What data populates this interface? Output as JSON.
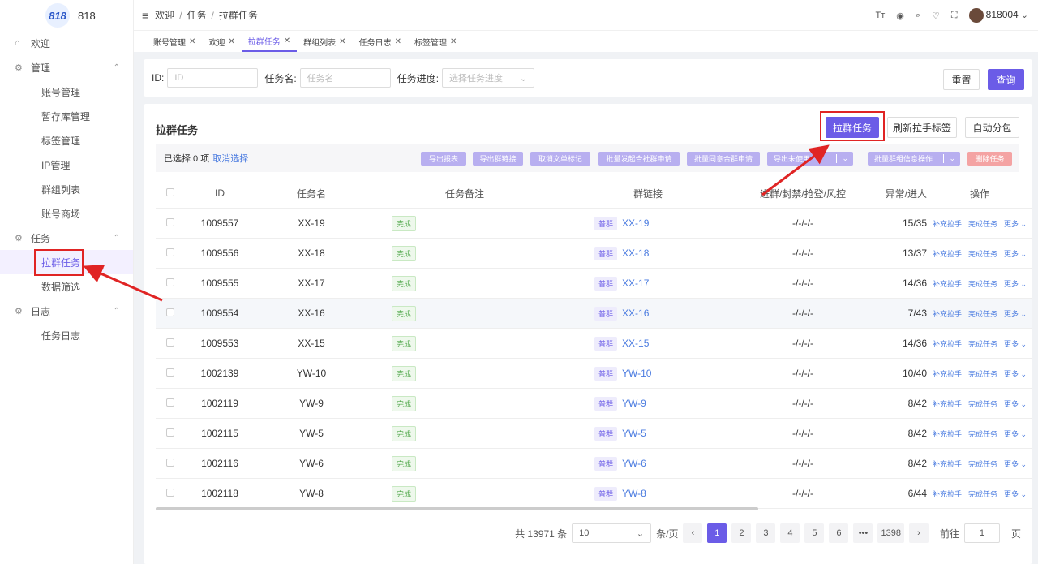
{
  "app": {
    "logo_mark": "818",
    "logo_text": "818"
  },
  "sidebar": {
    "items": [
      {
        "label": "欢迎",
        "icon": "home-icon"
      },
      {
        "label": "管理",
        "icon": "settings-icon"
      },
      {
        "label": "账号管理"
      },
      {
        "label": "暂存库管理"
      },
      {
        "label": "标签管理"
      },
      {
        "label": "IP管理"
      },
      {
        "label": "群组列表"
      },
      {
        "label": "账号商场"
      },
      {
        "label": "任务",
        "icon": "settings-icon"
      },
      {
        "label": "拉群任务"
      },
      {
        "label": "数据筛选"
      },
      {
        "label": "日志",
        "icon": "settings-icon"
      },
      {
        "label": "任务日志"
      }
    ]
  },
  "header": {
    "breadcrumb": [
      "欢迎",
      "任务",
      "拉群任务"
    ],
    "user": "818004"
  },
  "tabs": [
    "账号管理",
    "欢迎",
    "拉群任务",
    "群组列表",
    "任务日志",
    "标签管理"
  ],
  "filter": {
    "id_label": "ID:",
    "id_placeholder": "ID",
    "name_label": "任务名:",
    "name_placeholder": "任务名",
    "progress_label": "任务进度:",
    "progress_placeholder": "选择任务进度",
    "reset": "重置",
    "query": "查询"
  },
  "panel": {
    "title": "拉群任务",
    "actions": [
      "拉群任务",
      "刷新拉手标签",
      "自动分包"
    ],
    "selected_text": "已选择 0 项",
    "cancel_select": "取消选择",
    "bulk": [
      "导出报表",
      "导出群链接",
      "取消文单标记",
      "批量发起合社群申请",
      "批量同意合群申请",
      "导出未使用",
      "批量群组信息操作",
      "删除任务"
    ]
  },
  "table": {
    "headers": [
      "ID",
      "任务名",
      "任务备注",
      "群链接",
      "进群/封禁/抢登/风控",
      "异常/进人",
      "操作"
    ],
    "rows": [
      {
        "id": "1009557",
        "name": "XX-19",
        "status": "完成",
        "tag": "普群",
        "link": "XX-19",
        "stats": "-/-/-/-",
        "ratio": "15/35"
      },
      {
        "id": "1009556",
        "name": "XX-18",
        "status": "完成",
        "tag": "普群",
        "link": "XX-18",
        "stats": "-/-/-/-",
        "ratio": "13/37"
      },
      {
        "id": "1009555",
        "name": "XX-17",
        "status": "完成",
        "tag": "普群",
        "link": "XX-17",
        "stats": "-/-/-/-",
        "ratio": "14/36"
      },
      {
        "id": "1009554",
        "name": "XX-16",
        "status": "完成",
        "tag": "普群",
        "link": "XX-16",
        "stats": "-/-/-/-",
        "ratio": "7/43"
      },
      {
        "id": "1009553",
        "name": "XX-15",
        "status": "完成",
        "tag": "普群",
        "link": "XX-15",
        "stats": "-/-/-/-",
        "ratio": "14/36"
      },
      {
        "id": "1002139",
        "name": "YW-10",
        "status": "完成",
        "tag": "普群",
        "link": "YW-10",
        "stats": "-/-/-/-",
        "ratio": "10/40"
      },
      {
        "id": "1002119",
        "name": "YW-9",
        "status": "完成",
        "tag": "普群",
        "link": "YW-9",
        "stats": "-/-/-/-",
        "ratio": "8/42"
      },
      {
        "id": "1002115",
        "name": "YW-5",
        "status": "完成",
        "tag": "普群",
        "link": "YW-5",
        "stats": "-/-/-/-",
        "ratio": "8/42"
      },
      {
        "id": "1002116",
        "name": "YW-6",
        "status": "完成",
        "tag": "普群",
        "link": "YW-6",
        "stats": "-/-/-/-",
        "ratio": "8/42"
      },
      {
        "id": "1002118",
        "name": "YW-8",
        "status": "完成",
        "tag": "普群",
        "link": "YW-8",
        "stats": "-/-/-/-",
        "ratio": "6/44"
      }
    ],
    "ops": [
      "补充拉手",
      "完成任务",
      "更多"
    ]
  },
  "pagination": {
    "total": "共 13971 条",
    "page_size": "10",
    "per_page": "条/页",
    "pages": [
      "1",
      "2",
      "3",
      "4",
      "5",
      "6",
      "•••",
      "1398"
    ],
    "goto": "前往",
    "goto_value": "1",
    "page_unit": "页"
  }
}
